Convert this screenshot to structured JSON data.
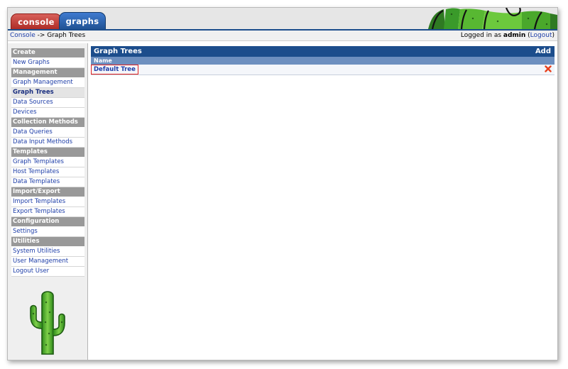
{
  "tabs": {
    "console_label": "console",
    "graphs_label": "graphs"
  },
  "breadcrumb": {
    "root": "Console",
    "separator": " -> ",
    "current": "Graph Trees"
  },
  "login": {
    "prefix": "Logged in as ",
    "user": "admin",
    "open_paren": " (",
    "logout_label": "Logout",
    "close_paren": ")"
  },
  "sidebar": {
    "sections": [
      {
        "heading": "Create",
        "items": [
          "New Graphs"
        ]
      },
      {
        "heading": "Management",
        "items": [
          "Graph Management",
          "Graph Trees",
          "Data Sources",
          "Devices"
        ]
      },
      {
        "heading": "Collection Methods",
        "items": [
          "Data Queries",
          "Data Input Methods"
        ]
      },
      {
        "heading": "Templates",
        "items": [
          "Graph Templates",
          "Host Templates",
          "Data Templates"
        ]
      },
      {
        "heading": "Import/Export",
        "items": [
          "Import Templates",
          "Export Templates"
        ]
      },
      {
        "heading": "Configuration",
        "items": [
          "Settings"
        ]
      },
      {
        "heading": "Utilities",
        "items": [
          "System Utilities",
          "User Management",
          "Logout User"
        ]
      }
    ],
    "active_item": "Graph Trees"
  },
  "panel": {
    "title": "Graph Trees",
    "add_label": "Add",
    "column_header": "Name",
    "rows": [
      {
        "name": "Default Tree"
      }
    ]
  },
  "colors": {
    "header_blue": "#1c4d8c",
    "console_tab_red": "#a8251f",
    "link_blue": "#1e3ea8",
    "highlight_red": "#e02020",
    "menu_heading_gray": "#999999"
  },
  "icons": {
    "delete": "delete-x-icon",
    "logo": "cactus-logo-icon"
  }
}
